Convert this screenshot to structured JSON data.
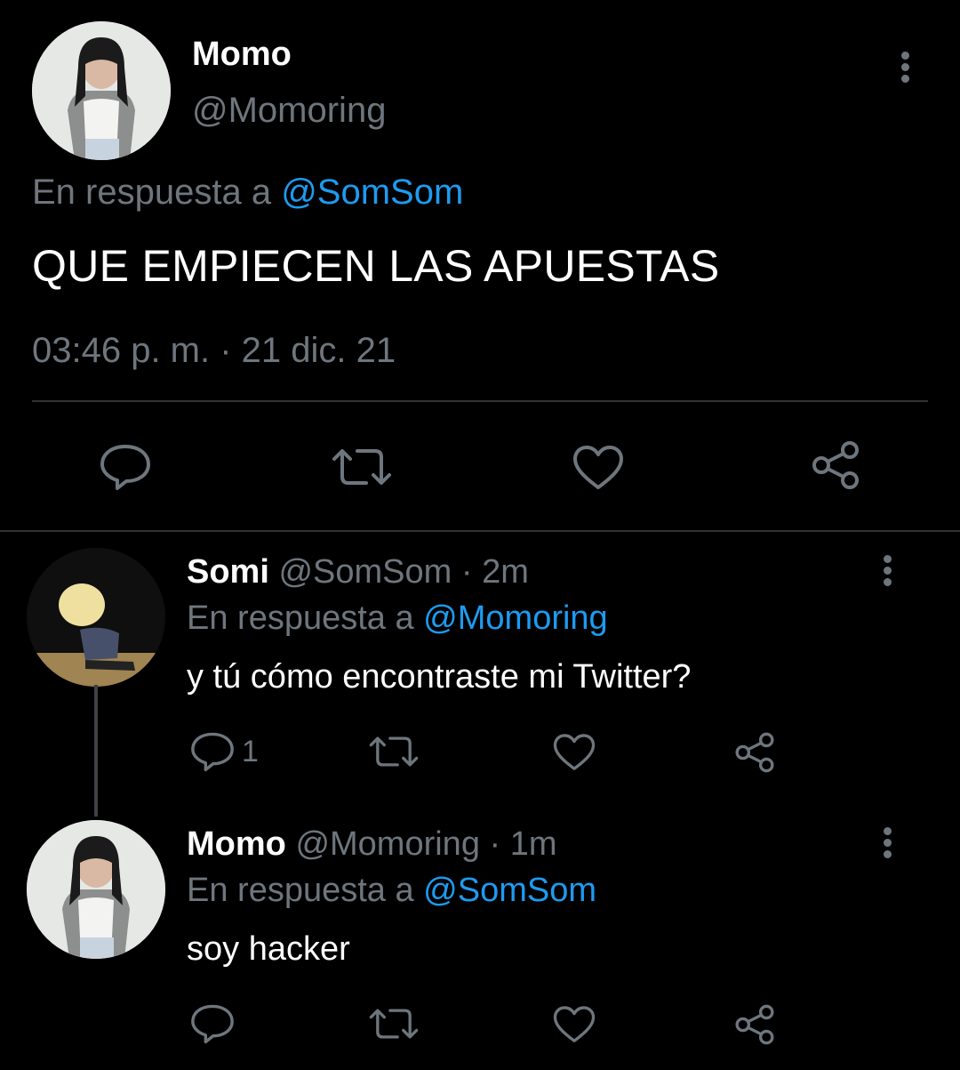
{
  "main_tweet": {
    "author_name": "Momo",
    "author_handle": "@Momoring",
    "reply_prefix": "En respuesta a",
    "reply_to": "@SomSom",
    "text": "QUE EMPIECEN LAS APUESTAS",
    "timestamp": "03:46 p. m. · 21 dic. 21",
    "actions": [
      "reply-icon",
      "retweet-icon",
      "like-icon",
      "share-icon"
    ]
  },
  "replies": [
    {
      "author_name": "Somi",
      "author_handle": "@SomSom",
      "time": "· 2m",
      "reply_prefix": "En respuesta a",
      "reply_to": "@Momoring",
      "text": "y tú cómo encontraste mi Twitter?",
      "reply_count": "1"
    },
    {
      "author_name": "Momo",
      "author_handle": "@Momoring",
      "time": "· 1m",
      "reply_prefix": "En respuesta a",
      "reply_to": "@SomSom",
      "text": "soy hacker",
      "reply_count": ""
    }
  ],
  "colors": {
    "background": "#000000",
    "muted": "#6e767d",
    "link": "#1d9bf0",
    "divider": "#2f3336"
  }
}
